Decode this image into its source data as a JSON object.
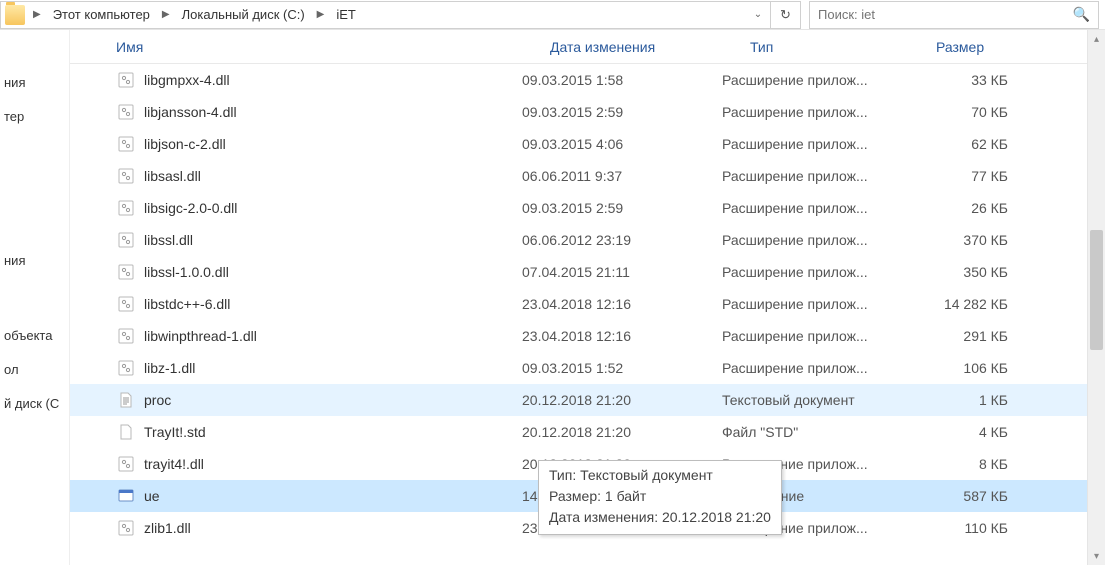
{
  "breadcrumbs": {
    "seg0": "Этот компьютер",
    "seg1": "Локальный диск (C:)",
    "seg2": "iET"
  },
  "search": {
    "placeholder": "Поиск: iet"
  },
  "columns": {
    "name": "Имя",
    "date": "Дата изменения",
    "type": "Тип",
    "size": "Размер"
  },
  "nav": {
    "n0": "ния",
    "n1": "тер",
    "n2": "ния",
    "n3": " объекта",
    "n4": "ол",
    "n5": "й диск (С"
  },
  "files": [
    {
      "icon": "dll",
      "name": "libgmpxx-4.dll",
      "date": "09.03.2015 1:58",
      "type": "Расширение прилож...",
      "size": "33 КБ",
      "sel": ""
    },
    {
      "icon": "dll",
      "name": "libjansson-4.dll",
      "date": "09.03.2015 2:59",
      "type": "Расширение прилож...",
      "size": "70 КБ",
      "sel": ""
    },
    {
      "icon": "dll",
      "name": "libjson-c-2.dll",
      "date": "09.03.2015 4:06",
      "type": "Расширение прилож...",
      "size": "62 КБ",
      "sel": ""
    },
    {
      "icon": "dll",
      "name": "libsasl.dll",
      "date": "06.06.2011 9:37",
      "type": "Расширение прилож...",
      "size": "77 КБ",
      "sel": ""
    },
    {
      "icon": "dll",
      "name": "libsigc-2.0-0.dll",
      "date": "09.03.2015 2:59",
      "type": "Расширение прилож...",
      "size": "26 КБ",
      "sel": ""
    },
    {
      "icon": "dll",
      "name": "libssl.dll",
      "date": "06.06.2012 23:19",
      "type": "Расширение прилож...",
      "size": "370 КБ",
      "sel": ""
    },
    {
      "icon": "dll",
      "name": "libssl-1.0.0.dll",
      "date": "07.04.2015 21:11",
      "type": "Расширение прилож...",
      "size": "350 КБ",
      "sel": ""
    },
    {
      "icon": "dll",
      "name": "libstdc++-6.dll",
      "date": "23.04.2018 12:16",
      "type": "Расширение прилож...",
      "size": "14 282 КБ",
      "sel": ""
    },
    {
      "icon": "dll",
      "name": "libwinpthread-1.dll",
      "date": "23.04.2018 12:16",
      "type": "Расширение прилож...",
      "size": "291 КБ",
      "sel": ""
    },
    {
      "icon": "dll",
      "name": "libz-1.dll",
      "date": "09.03.2015 1:52",
      "type": "Расширение прилож...",
      "size": "106 КБ",
      "sel": ""
    },
    {
      "icon": "txt",
      "name": "proc",
      "date": "20.12.2018 21:20",
      "type": "Текстовый документ",
      "size": "1 КБ",
      "sel": "soft"
    },
    {
      "icon": "file",
      "name": "TrayIt!.std",
      "date": "20.12.2018 21:20",
      "type": "Файл \"STD\"",
      "size": "4 КБ",
      "sel": ""
    },
    {
      "icon": "dll",
      "name": "trayit4!.dll",
      "date": "20.12.2018 21:20",
      "type": "Расширение прилож...",
      "size": "8 КБ",
      "sel": ""
    },
    {
      "icon": "exe",
      "name": "ue",
      "date": "14.12.2018 10:00",
      "type": "Приложение",
      "size": "587 КБ",
      "sel": "hard"
    },
    {
      "icon": "dll",
      "name": "zlib1.dll",
      "date": "23.04.2018 12:16",
      "type": "Расширение прилож...",
      "size": "110 КБ",
      "sel": ""
    }
  ],
  "tooltip": {
    "line1": "Тип: Текстовый документ",
    "line2": "Размер: 1 байт",
    "line3": "Дата изменения: 20.12.2018 21:20"
  }
}
